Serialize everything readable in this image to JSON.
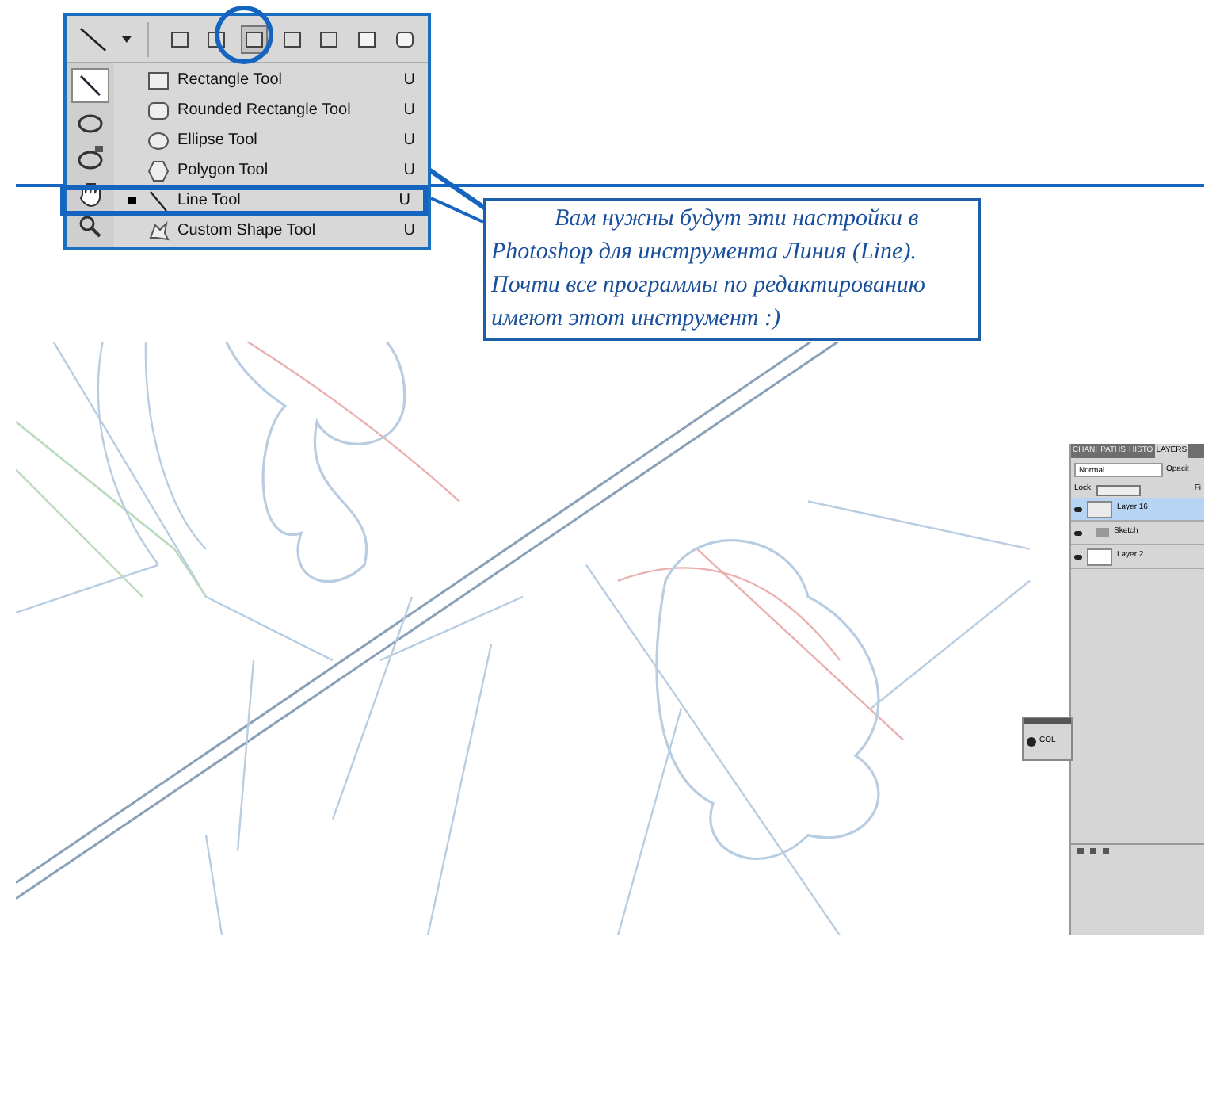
{
  "options_bar": {
    "shape_tools": [
      {
        "selected": false
      },
      {
        "selected": false
      },
      {
        "selected": true
      },
      {
        "selected": false
      },
      {
        "selected": false
      },
      {
        "selected": false
      },
      {
        "selected": false
      }
    ]
  },
  "shape_menu": {
    "items": [
      {
        "label": "Rectangle Tool",
        "shortcut": "U",
        "selected": false,
        "kind": "rect"
      },
      {
        "label": "Rounded Rectangle Tool",
        "shortcut": "U",
        "selected": false,
        "kind": "rounded"
      },
      {
        "label": "Ellipse Tool",
        "shortcut": "U",
        "selected": false,
        "kind": "ellipse"
      },
      {
        "label": "Polygon Tool",
        "shortcut": "U",
        "selected": false,
        "kind": "polygon"
      },
      {
        "label": "Line Tool",
        "shortcut": "U",
        "selected": true,
        "kind": "line"
      },
      {
        "label": "Custom Shape Tool",
        "shortcut": "U",
        "selected": false,
        "kind": "custom"
      }
    ]
  },
  "caption": "Вам нужны будут эти настройки в Photoshop для инструмента Линия (Line). Почти все программы по редактированию имеют этот инструмент :)",
  "layers_panel": {
    "tabs": [
      {
        "label": "CHANI",
        "selected": false
      },
      {
        "label": "PATHS",
        "selected": false
      },
      {
        "label": "HISTO",
        "selected": false
      },
      {
        "label": "LAYERS",
        "selected": true
      }
    ],
    "blend_mode": "Normal",
    "opacity_label": "Opacit",
    "lock_label": "Lock:",
    "fill_label": "Fi",
    "layers": [
      {
        "name": "Layer 16",
        "kind": "transparent",
        "selected": true
      },
      {
        "name": "Sketch",
        "kind": "group",
        "selected": false
      },
      {
        "name": "Layer 2",
        "kind": "white",
        "selected": false
      }
    ]
  },
  "color_panel": {
    "label": "COL"
  }
}
